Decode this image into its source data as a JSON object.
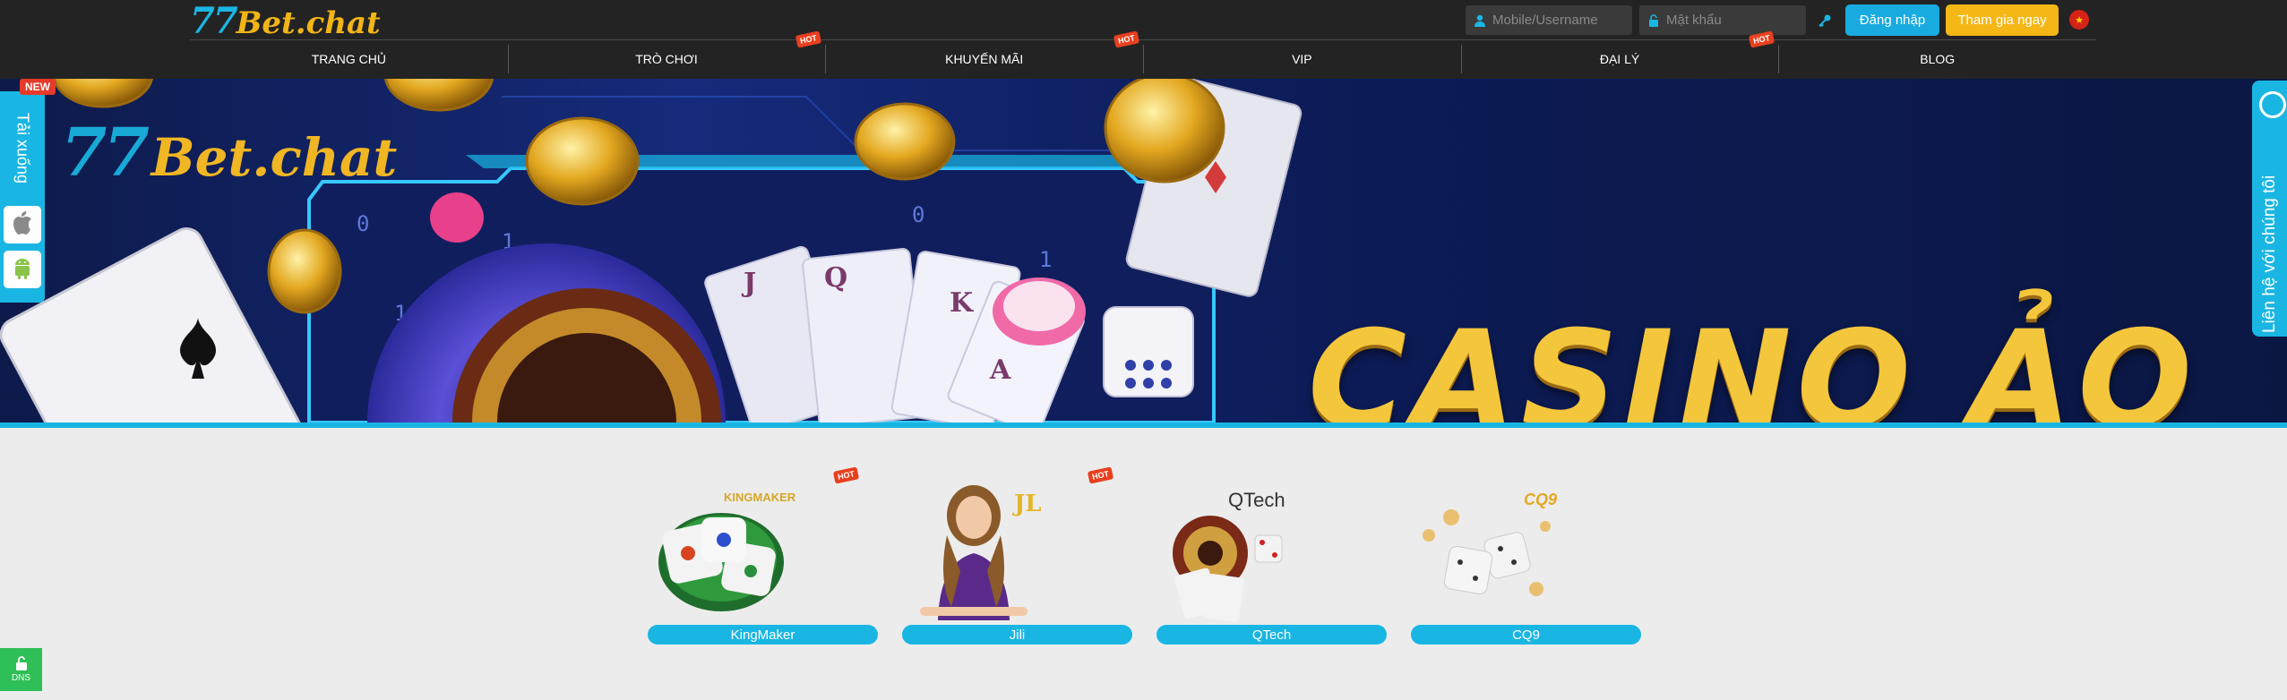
{
  "header": {
    "logo_num": "77",
    "logo_text": "Bet.chat",
    "username_placeholder": "Mobile/Username",
    "password_placeholder": "Mật khẩu",
    "login_label": "Đăng nhập",
    "join_label": "Tham gia ngay",
    "language_flag": "Vietnam"
  },
  "nav": {
    "items": [
      {
        "label": "TRANG CHỦ",
        "hot": false
      },
      {
        "label": "TRÒ CHƠI",
        "hot": true
      },
      {
        "label": "KHUYẾN MÃI",
        "hot": true
      },
      {
        "label": "VIP",
        "hot": false
      },
      {
        "label": "ĐẠI LÝ",
        "hot": true
      },
      {
        "label": "BLOG",
        "hot": false
      }
    ],
    "hot_badge": "HOT"
  },
  "banner": {
    "logo_num": "77",
    "logo_text": "Bet.chat",
    "title": "CASINO ẢO"
  },
  "download": {
    "new_badge": "NEW",
    "label": "Tải xuống",
    "ios_icon": "apple-icon",
    "android_icon": "android-icon"
  },
  "contact": {
    "label": "Liên hệ với chúng tôi",
    "icon": "whatsapp-icon"
  },
  "providers": [
    {
      "label": "KingMaker",
      "brand": "KINGMAKER",
      "hot": true
    },
    {
      "label": "Jili",
      "brand": "JL",
      "hot": true
    },
    {
      "label": "QTech",
      "brand": "QTech",
      "hot": false
    },
    {
      "label": "CQ9",
      "brand": "CQ9",
      "hot": false
    }
  ],
  "dns": {
    "label": "DNS",
    "icon": "unlock-icon"
  },
  "colors": {
    "accent": "#1ab6e3",
    "gold": "#f5b716",
    "header_bg": "#232323",
    "page_bg": "#ececec",
    "hot": "#e8401f",
    "dns": "#2fbf57"
  }
}
